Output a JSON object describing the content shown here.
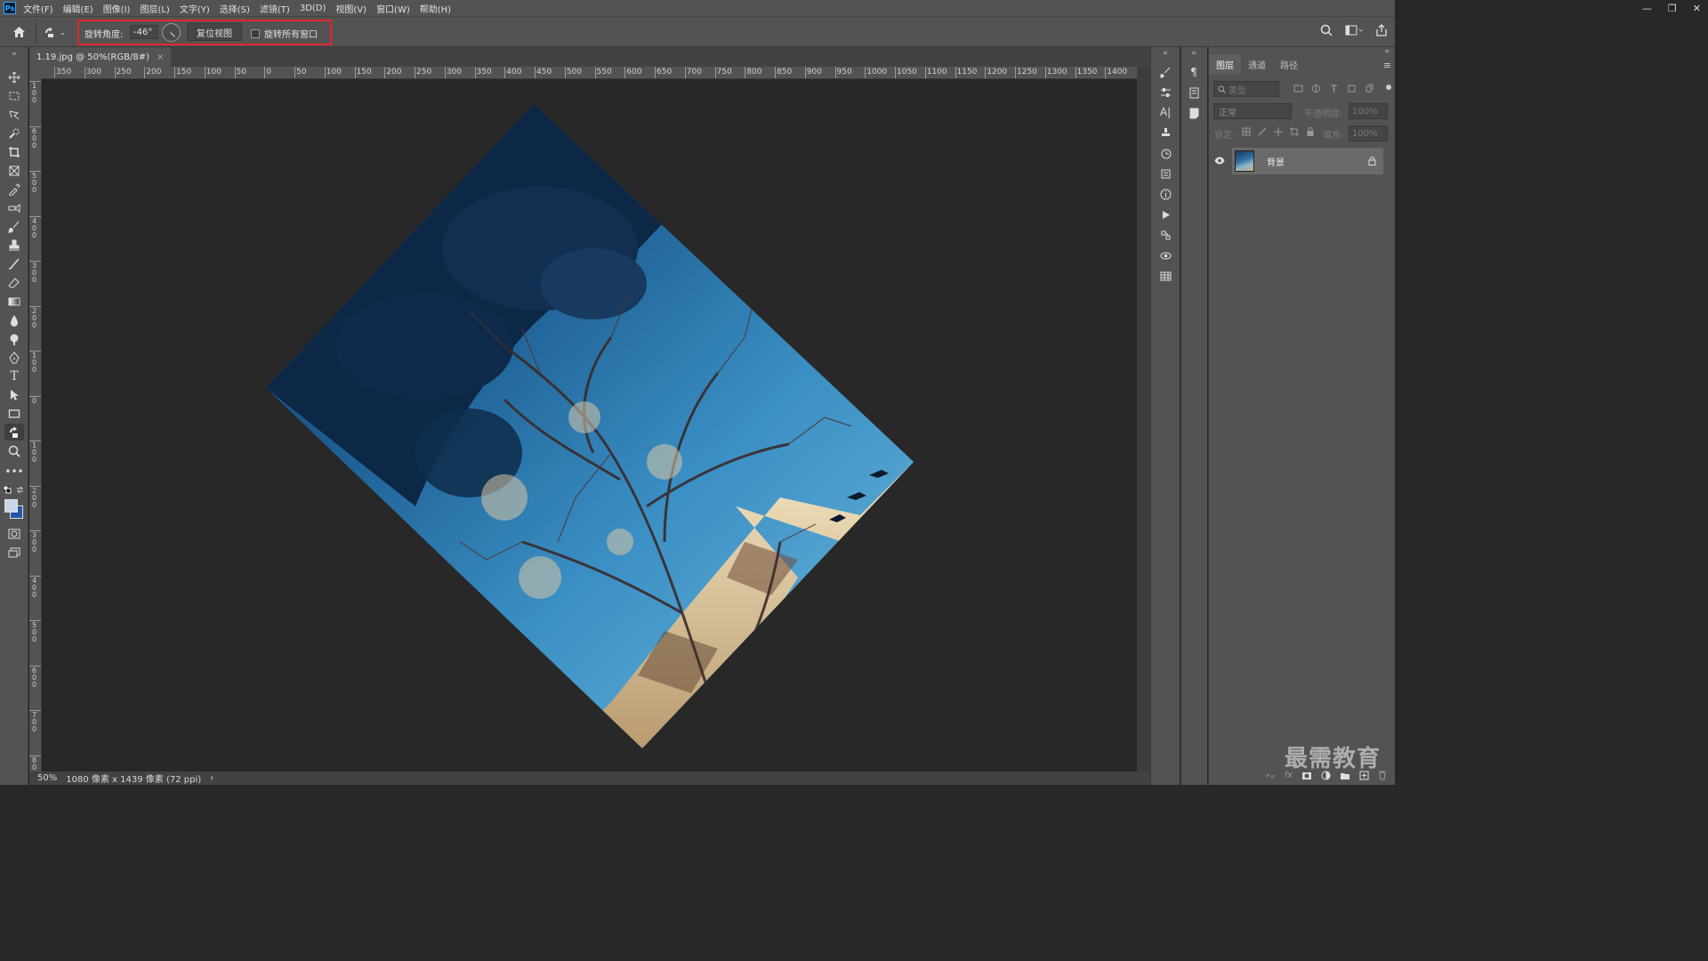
{
  "menu": {
    "items": [
      "文件(F)",
      "编辑(E)",
      "图像(I)",
      "图层(L)",
      "文字(Y)",
      "选择(S)",
      "滤镜(T)",
      "3D(D)",
      "视图(V)",
      "窗口(W)",
      "帮助(H)"
    ]
  },
  "app_logo": "Ps",
  "window_controls": [
    "—",
    "❐",
    "✕"
  ],
  "options": {
    "rotate_label": "旋转角度:",
    "rotate_value": "-46°",
    "reset_view": "复位视图",
    "rotate_all_label": "旋转所有窗口",
    "rotate_all_checked": false
  },
  "document": {
    "tab_title": "1.19.jpg @ 50%(RGB/8#)",
    "tab_close": "×",
    "rotation_deg": -46,
    "zoom": "50%",
    "doc_info": "1080 像素 x 1439 像素 (72 ppi)",
    "doc_info_arrow": "›"
  },
  "ruler": {
    "h_labels": [
      "350",
      "300",
      "250",
      "200",
      "150",
      "100",
      "50",
      "0",
      "50",
      "100",
      "150",
      "200",
      "250",
      "300",
      "350",
      "400",
      "450",
      "500",
      "550",
      "600",
      "650",
      "700",
      "750",
      "800",
      "850",
      "900",
      "950",
      "1000",
      "1050",
      "1100",
      "1150",
      "1200",
      "1250",
      "1300",
      "1350",
      "1400"
    ],
    "v_labels": [
      "1\n0\n0",
      "6\n0\n0",
      "5\n0\n0",
      "4\n0\n0",
      "3\n0\n0",
      "2\n0\n0",
      "1\n0\n0",
      "0",
      "1\n0\n0",
      "2\n0\n0",
      "3\n0\n0",
      "4\n0\n0",
      "5\n0\n0",
      "6\n0\n0",
      "7\n0\n0",
      "8\n0\n0"
    ]
  },
  "layers_panel": {
    "tabs": [
      "图层",
      "通道",
      "路径"
    ],
    "active_tab": 0,
    "search_placeholder": "类型",
    "blend_mode": "正常",
    "opacity_label": "不透明度:",
    "opacity_value": "100%",
    "lock_label": "锁定:",
    "fill_label": "填充:",
    "fill_value": "100%",
    "layers": [
      {
        "name": "背景",
        "visible": true,
        "locked": true
      }
    ]
  },
  "watermark": "最需教育",
  "colors": {
    "highlight": "#e2262c",
    "foreground": "#c8d8ea",
    "background": "#2456a8"
  }
}
